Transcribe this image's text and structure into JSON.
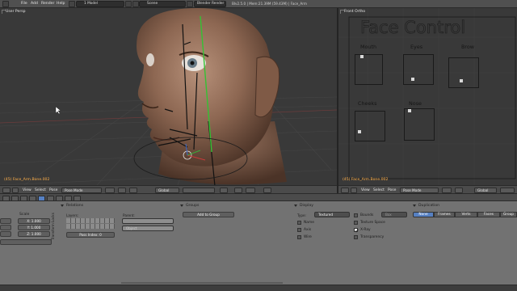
{
  "app": {
    "menu": [
      "File",
      "Add",
      "Render",
      "Help"
    ],
    "layout_value": "1 Model",
    "scene_value": "Scene",
    "engine_value": "Blender Render",
    "info_text": "Blv2.5.0 | Mem:21.39M (59.43M) | Face_Arm"
  },
  "viewport_left": {
    "title": "User Persp",
    "object_label": "(45) Face_Arm.Bone.002",
    "header": {
      "menus": [
        "View",
        "Select",
        "Pose"
      ],
      "mode": "Pose Mode",
      "orientation": "Global"
    }
  },
  "viewport_right": {
    "title": "Front Ortho",
    "object_label": "(45) Face_Arm.Bone.002",
    "header": {
      "menus": [
        "View",
        "Select",
        "Pose"
      ],
      "mode": "Pose Mode",
      "orientation": "Global"
    },
    "face_control": {
      "title": "Face Control",
      "widgets": [
        {
          "label": "Mouth"
        },
        {
          "label": "Eyes"
        },
        {
          "label": "Brow"
        },
        {
          "label": "Cheeks"
        },
        {
          "label": "Nose"
        }
      ]
    }
  },
  "properties": {
    "side_tab": "Transform Locks",
    "scale": {
      "title": "Scale",
      "x": "X: 1.000",
      "y": "Y: 1.000",
      "z": "Z: 1.000"
    },
    "relations": {
      "title": "Relations",
      "layers_label": "Layers:",
      "parent_label": "Parent:",
      "parent_value": "",
      "object_value": "Object",
      "pass_index": "Pass Index: 0"
    },
    "groups": {
      "title": "Groups",
      "add_button": "Add to Group"
    },
    "display": {
      "title": "Display",
      "type_label": "Type:",
      "type_value": "Textured",
      "bounds_label": "Bounds",
      "bounds_value": "Box",
      "checks": [
        {
          "label": "Name",
          "checked": false
        },
        {
          "label": "Axis",
          "checked": false
        },
        {
          "label": "Wire",
          "checked": false
        }
      ],
      "checks_right": [
        {
          "label": "Texture Space",
          "checked": false
        },
        {
          "label": "X-Ray",
          "checked": true
        },
        {
          "label": "Transparency",
          "checked": false
        }
      ]
    },
    "duplication": {
      "title": "Duplication",
      "options": [
        "None",
        "Frames",
        "Verts",
        "Faces",
        "Group"
      ],
      "active": "None"
    }
  },
  "colors": {
    "accent": "#5680c2",
    "object_label": "#ffb04a",
    "viewport_bg": "#393939",
    "panel_bg": "#727272"
  }
}
